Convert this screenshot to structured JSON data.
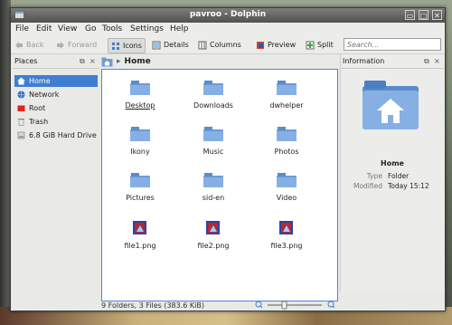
{
  "window": {
    "title": "pavroo - Dolphin"
  },
  "menubar": {
    "items": [
      "File",
      "Edit",
      "View",
      "Go",
      "Tools",
      "Settings",
      "Help"
    ]
  },
  "toolbar": {
    "back": "Back",
    "forward": "Forward",
    "icons": "Icons",
    "details": "Details",
    "columns": "Columns",
    "preview": "Preview",
    "split": "Split",
    "search_placeholder": "Search..."
  },
  "places": {
    "title": "Places",
    "items": [
      {
        "label": "Home",
        "icon": "home-icon",
        "selected": true
      },
      {
        "label": "Network",
        "icon": "network-icon"
      },
      {
        "label": "Root",
        "icon": "root-folder-icon"
      },
      {
        "label": "Trash",
        "icon": "trash-icon"
      },
      {
        "label": "6.8 GiB Hard Drive",
        "icon": "hard-drive-icon"
      }
    ]
  },
  "location": {
    "crumb": "Home"
  },
  "files": [
    {
      "name": "Desktop",
      "kind": "folder"
    },
    {
      "name": "Downloads",
      "kind": "folder"
    },
    {
      "name": "dwhelper",
      "kind": "folder"
    },
    {
      "name": "Ikony",
      "kind": "folder"
    },
    {
      "name": "Music",
      "kind": "folder"
    },
    {
      "name": "Photos",
      "kind": "folder"
    },
    {
      "name": "Pictures",
      "kind": "folder"
    },
    {
      "name": "sid-en",
      "kind": "folder"
    },
    {
      "name": "Video",
      "kind": "folder"
    },
    {
      "name": "file1.png",
      "kind": "image"
    },
    {
      "name": "file2.png",
      "kind": "image"
    },
    {
      "name": "file3.png",
      "kind": "image"
    }
  ],
  "status": {
    "summary": "9 Folders, 3 Files (383.6 KiB)"
  },
  "info": {
    "title": "Information",
    "name": "Home",
    "type_key": "Type",
    "type_val": "Folder",
    "modified_key": "Modified",
    "modified_val": "Today 15:12"
  },
  "colors": {
    "selection": "#3f7ed0",
    "folder": "#6d9bd6",
    "titlebar": "#5e5e5c"
  }
}
